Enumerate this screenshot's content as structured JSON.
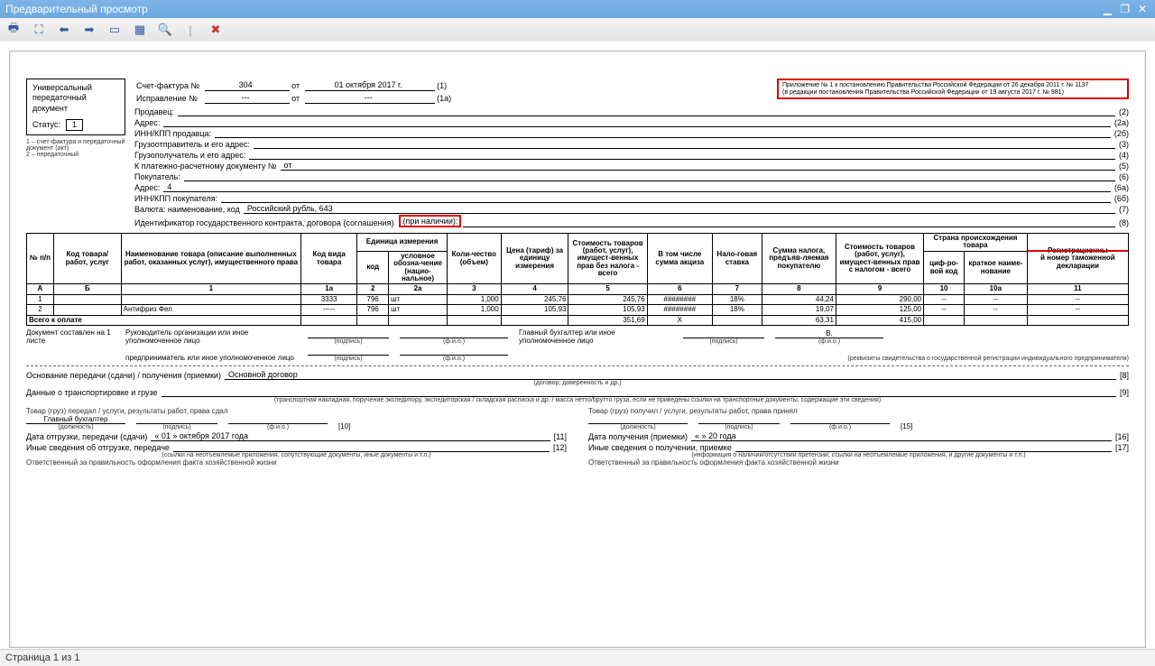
{
  "window": {
    "title": "Предварительный просмотр"
  },
  "status_bar": "Страница 1 из 1",
  "toolbar": [
    "print",
    "fit",
    "prev",
    "next",
    "page",
    "grid",
    "zoom-out",
    "divider",
    "close"
  ],
  "legislation": {
    "line1": "Приложение № 1 к постановлению Правительства Российской Федерации от 26 декабря 2011 г. № 1137",
    "line2": "(в редакции постановления Правительства Российской Федерации от 19 августа 2017 г. № 981)"
  },
  "upd_box": {
    "l1": "Универсальный",
    "l2": "передаточный",
    "l3": "документ",
    "status_lbl": "Статус:",
    "status_val": "1",
    "note1": "1 – счет-фактура и передаточный документ (акт)",
    "note2": "2 – передаточный"
  },
  "header": {
    "sf_lbl": "Счет-фактура №",
    "sf_no": "304",
    "sf_ot": "от",
    "sf_date": "01 октября 2017 г.",
    "sf_par": "(1)",
    "isp_lbl": "Исправление №",
    "isp_no": "---",
    "isp_ot": "от",
    "isp_date": "---",
    "isp_par": "(1а)",
    "rows": [
      {
        "lab": "Продавец:",
        "val": "",
        "par": "(2)"
      },
      {
        "lab": "Адрес:",
        "val": "",
        "par": "(2а)"
      },
      {
        "lab": "ИНН/КПП продавца:",
        "val": "",
        "par": "(2б)"
      },
      {
        "lab": "Грузоотправитель и его адрес:",
        "val": "",
        "par": "(3)"
      },
      {
        "lab": "Грузополучатель и его адрес:",
        "val": "",
        "par": "(4)"
      },
      {
        "lab": "К платежно-расчетному документу №",
        "val": "   от",
        "par": "(5)"
      },
      {
        "lab": "Покупатель:",
        "val": "",
        "par": "(6)"
      },
      {
        "lab": "Адрес:",
        "val": "4",
        "par": "(6а)"
      },
      {
        "lab": "ИНН/КПП покупателя:",
        "val": "",
        "par": "(6б)"
      },
      {
        "lab": "Валюта: наименование, код",
        "val": "Российский рубль, 643",
        "par": "(7)"
      },
      {
        "lab": "Идентификатор государственного контракта, договора (соглашения)",
        "suffix": "(при наличии):",
        "val": "",
        "par": "(8)"
      }
    ]
  },
  "grid": {
    "headers": {
      "c_no": "№ п/п",
      "c_code": "Код товара/ работ, услуг",
      "c_name": "Наименование товара (описание выполненных работ, оказанных услуг), имущественного права",
      "c_kind": "Код вида товара",
      "c_unit": "Единица измерения",
      "c_unit_code": "код",
      "c_unit_name": "условное обозна-чение (нацио-нальное)",
      "c_qty": "Коли-чество (объем)",
      "c_price": "Цена (тариф) за единицу измерения",
      "c_cost": "Стоимость товаров (работ, услуг), имущест-венных прав без налога - всего",
      "c_excise": "В том числе сумма акциза",
      "c_rate": "Нало-говая ставка",
      "c_tax": "Сумма налога, предъяв-ляемая покупателю",
      "c_total": "Стоимость товаров (работ, услуг), имущест-венных прав с налогом - всего",
      "c_country": "Страна происхождения товара",
      "c_country_code": "циф-ро-вой код",
      "c_country_name": "краткое наиме-нование",
      "c_reg": "Регистрационны",
      "c_reg2": "й номер таможенной декларации"
    },
    "numrow": [
      "А",
      "Б",
      "1",
      "1а",
      "2",
      "2а",
      "3",
      "4",
      "5",
      "6",
      "7",
      "8",
      "9",
      "10",
      "10а",
      "11"
    ],
    "rows": [
      {
        "n": "1",
        "code": "",
        "name": "",
        "kind": "3333",
        "ucode": "796",
        "uname": "шт",
        "qty": "1,000",
        "price": "245,76",
        "cost": "245,76",
        "excise": "########",
        "rate": "18%",
        "tax": "44,24",
        "total": "290,00",
        "cc": "--",
        "cn": "--",
        "reg": "--"
      },
      {
        "n": "2",
        "code": "",
        "name": "Антифриз Фел",
        "kind": "-----",
        "ucode": "796",
        "uname": "шт",
        "qty": "1,000",
        "price": "105,93",
        "cost": "105,93",
        "excise": "########",
        "rate": "18%",
        "tax": "19,07",
        "total": "125,00",
        "cc": "--",
        "cn": "--",
        "reg": "--"
      }
    ],
    "total": {
      "label": "Всего к оплате",
      "cost": "351,69",
      "excise": "Х",
      "tax": "63,31",
      "total": "415,00"
    }
  },
  "footer": {
    "doc_pages": "Документ составлен на 1 листе",
    "s_left1": "Руководитель организации или иное уполномоченное лицо",
    "s_left2": "Главный бухгалтер или иное уполномоченное лицо",
    "s_biz": "предприниматель или иное уполномоченное лицо",
    "cap_sign": "(подпись)",
    "cap_fio": "(ф.и.о.)",
    "cap_reg": "(реквизиты свидетельства о государственной регистрации индивидуального предпринимателя)",
    "basis_lbl": "Основание передачи (сдачи) / получения (приемки)",
    "basis_val": "Основной договор",
    "basis_par": "[8]",
    "basis_cap": "(договор; доверенность и др.)",
    "trans_lbl": "Данные о транспортировке и грузе",
    "trans_par": "[9]",
    "trans_cap": "(транспортная накладная, поручение экспедитору, экспедиторская / складская расписка и др. / масса нетто/брутто груза, если не приведены ссылки на транспортные документы, содержащие эти сведения)",
    "left": {
      "h": "Товар (груз) передал / услуги, результаты работ, права сдал",
      "pos": "Главный бухгалтер",
      "par1": "[10]",
      "cap_pos": "(должность)",
      "date_lbl": "Дата отгрузки, передачи (сдачи)",
      "date_val": "« 01 »   октября   2017   года",
      "par2": "[11]",
      "misc": "Иные сведения об отгрузке, передаче",
      "par3": "[12]",
      "misc_cap": "(ссылки на неотъемлемые приложения, сопутствующие документы, иные документы и т.п.)",
      "resp": "Ответственный за правильность оформления факта хозяйственной жизни"
    },
    "right": {
      "h": "Товар (груз) получил / услуги, результаты работ, права принял",
      "par1": "[15]",
      "date_lbl": "Дата получения (приемки)",
      "date_val": "«        »                    20       года",
      "par2": "[16]",
      "misc": "Иные сведения о получении, приемке",
      "par3": "[17]",
      "misc_cap": "(информация о наличии/отсутствии претензии; ссылки на неотъемлемые приложения, и другие документы и т.п.)",
      "resp": "Ответственный за правильность оформления факта хозяйственной жизни"
    }
  }
}
